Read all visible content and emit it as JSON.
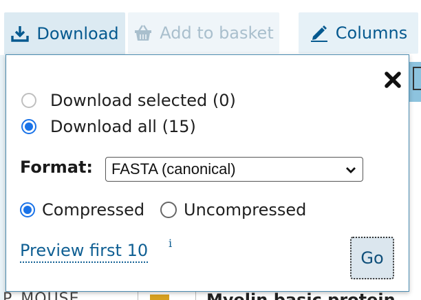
{
  "toolbar": {
    "download_label": "Download",
    "add_to_basket_label": "Add to basket",
    "columns_label": "Columns"
  },
  "background": {
    "row_text": "P_MOUSE",
    "row_title": "Myelin basic protein"
  },
  "download_popup": {
    "options": {
      "selected_label": "Download selected (0)",
      "all_label": "Download all (15)",
      "selected_checked": false,
      "all_checked": true
    },
    "format": {
      "label": "Format:",
      "value": "FASTA (canonical)"
    },
    "compression": {
      "compressed_label": "Compressed",
      "uncompressed_label": "Uncompressed",
      "compressed_checked": true
    },
    "preview_label": "Preview first 10",
    "info_marker": "i",
    "go_label": "Go"
  },
  "colors": {
    "accent": "#1a73e8",
    "link": "#0f5f93",
    "toolbar_text": "#05598f",
    "toolbar_bg": "#e6f1f7",
    "header_strip": "#8dc3de"
  },
  "icons": [
    "download-icon",
    "basket-icon",
    "pencil-icon",
    "close-icon",
    "chevron-down-icon"
  ]
}
